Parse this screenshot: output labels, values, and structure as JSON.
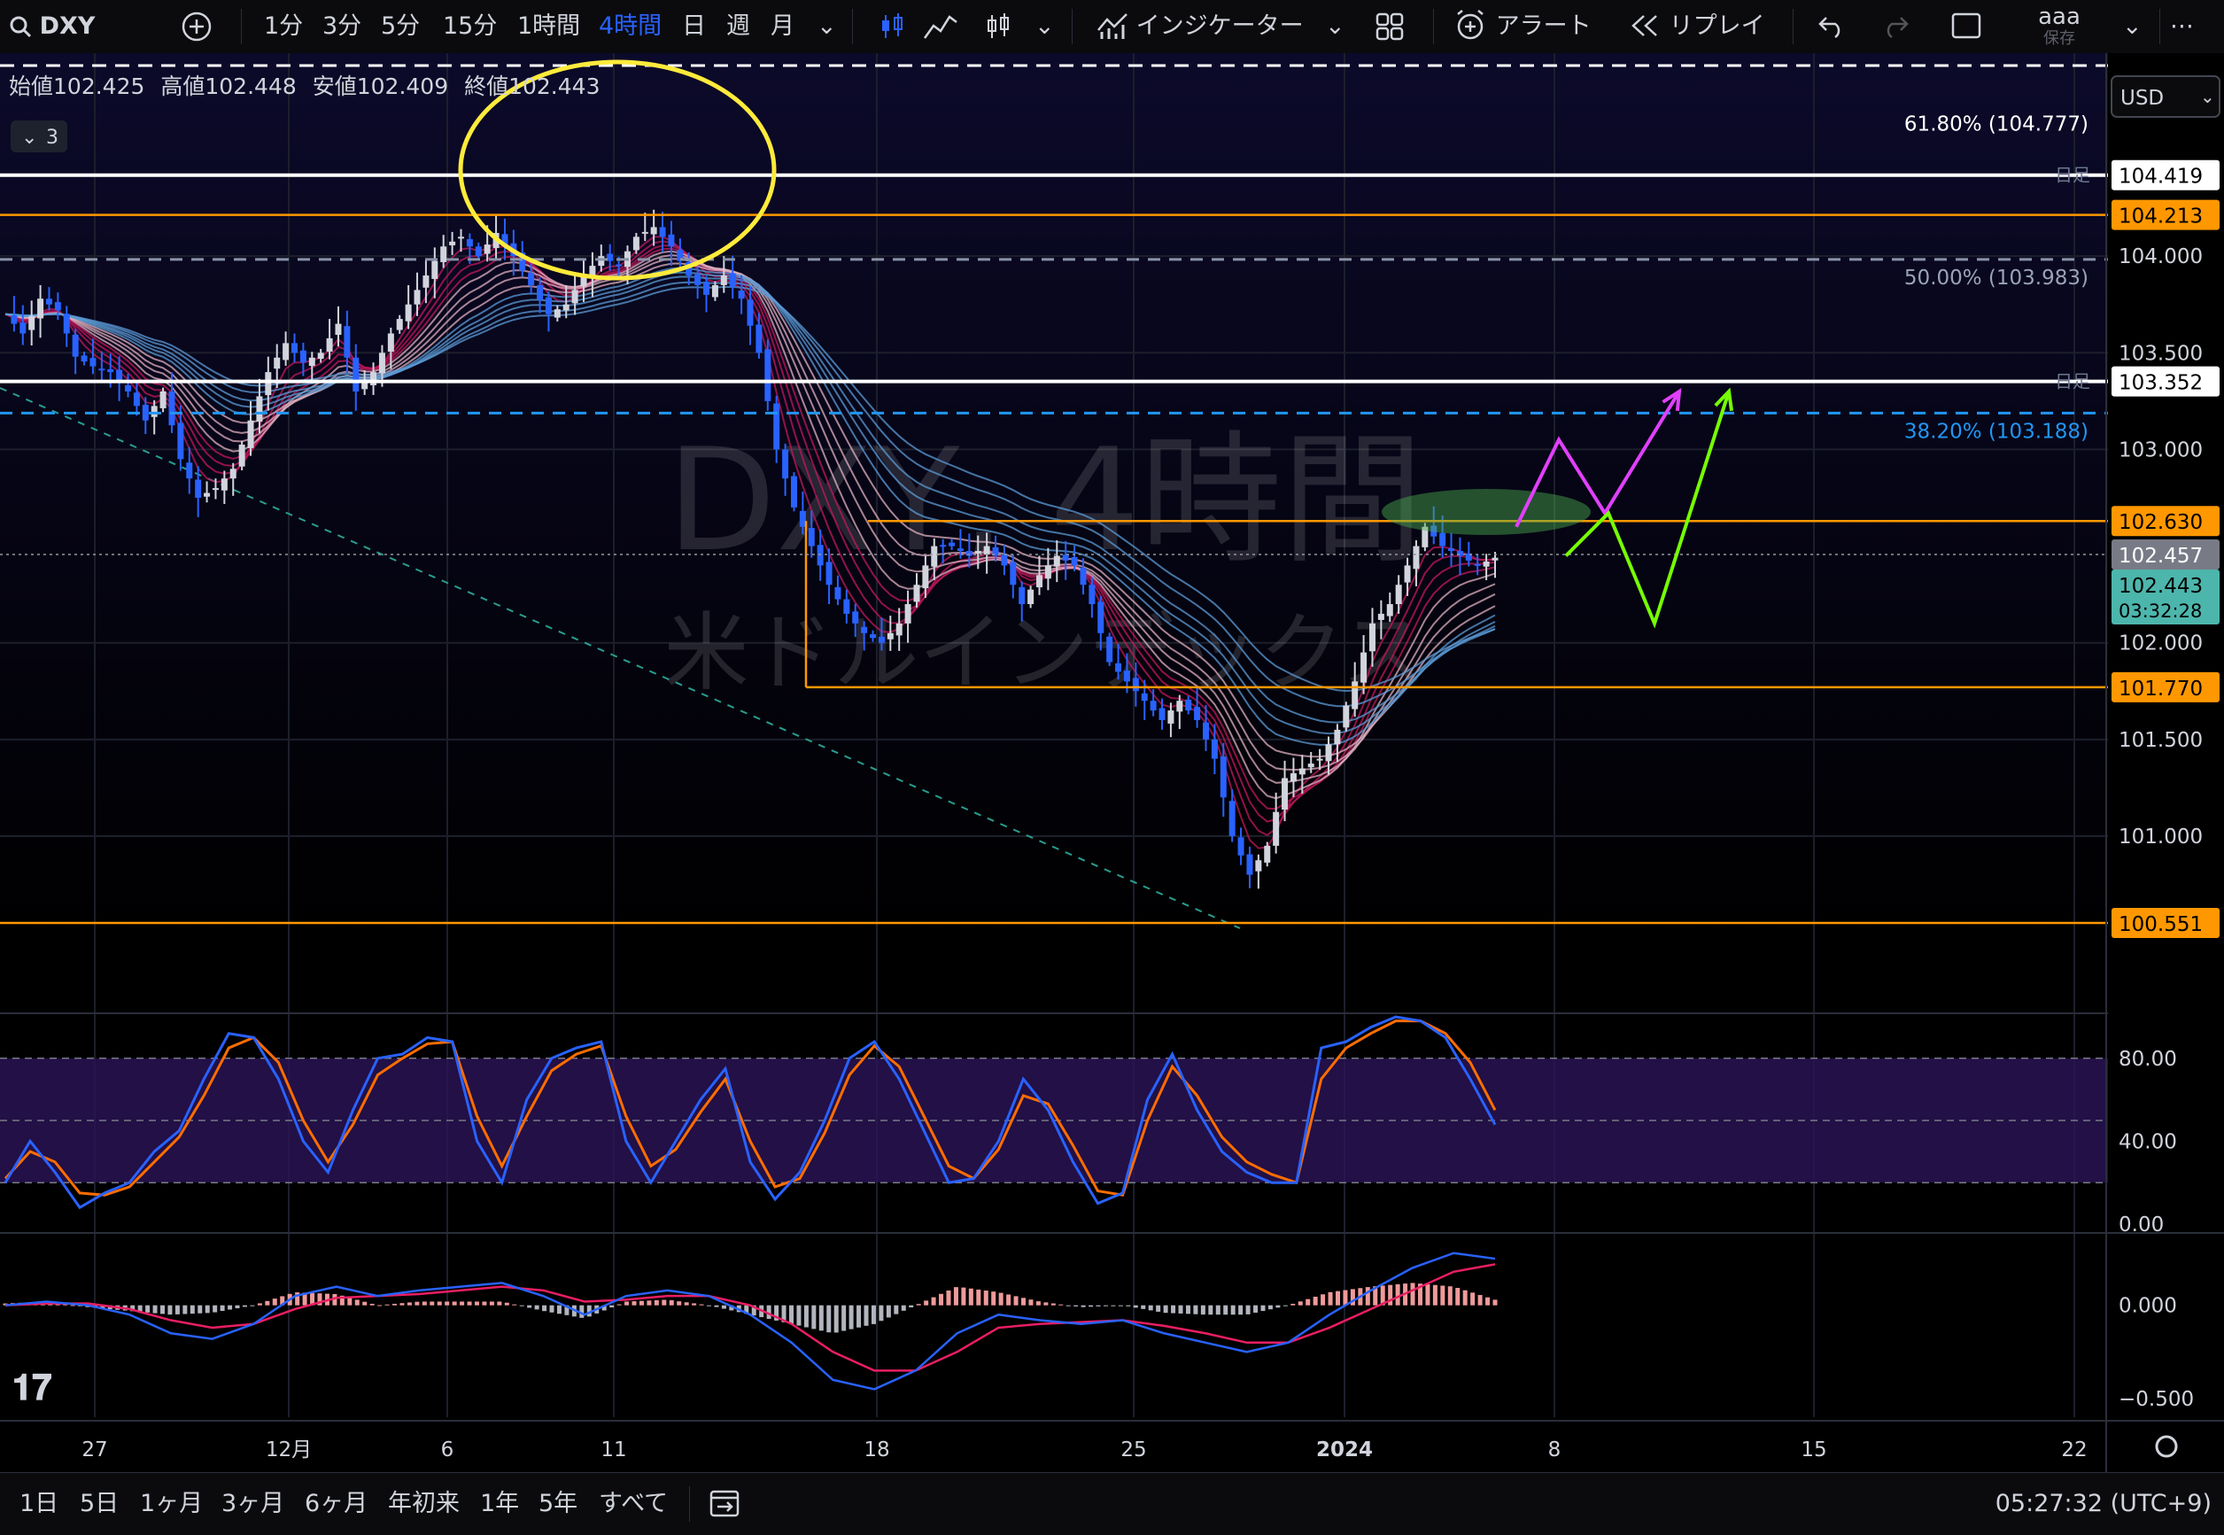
{
  "symbol": "DXY",
  "toolbar": {
    "intervals": [
      "1分",
      "3分",
      "5分",
      "15分",
      "1時間",
      "4時間",
      "日",
      "週",
      "月"
    ],
    "active_interval": "4時間",
    "indicators_label": "インジケーター",
    "alert_label": "アラート",
    "replay_label": "リプレイ",
    "user_name": "aaa",
    "save_label": "保存"
  },
  "legend": {
    "open_label": "始値",
    "open": "102.425",
    "high_label": "高値",
    "high": "102.448",
    "low_label": "安値",
    "low": "102.409",
    "close_label": "終値",
    "close": "102.443",
    "collapse_count": "3"
  },
  "currency": "USD",
  "watermark": {
    "title": "DXY, 4時間",
    "subtitle": "米ドルインデックス"
  },
  "bottom": {
    "ranges": [
      "1日",
      "5日",
      "1ヶ月",
      "3ヶ月",
      "6ヶ月",
      "年初来",
      "1年",
      "5年",
      "すべて"
    ],
    "clock": "05:27:32 (UTC+9)"
  },
  "colors": {
    "up": "#d1d4dc",
    "down": "#2962ff",
    "orange": "#ff9800",
    "fib_blue": "#2196f3",
    "ribbon_red": "#c2185b",
    "ribbon_blue": "#5b9bd5",
    "stoch_k": "#2962ff",
    "stoch_d": "#ff6d00",
    "macd_line": "#2962ff",
    "signal_line": "#e91e63",
    "hist_pos": "#ef9a9a",
    "hist_neg": "#b2b5be"
  },
  "chart_data": {
    "type": "candlestick",
    "price_axis": {
      "ticks": [
        "104.000",
        "103.500",
        "103.000",
        "102.000",
        "101.500",
        "101.000"
      ],
      "range": [
        100.45,
        105.05
      ]
    },
    "time_axis": {
      "ticks": [
        "27",
        "12月",
        "6",
        "11",
        "18",
        "25",
        "2024",
        "8",
        "15",
        "22"
      ]
    },
    "last_price": "102.443",
    "countdown": "03:32:28",
    "horizontal_levels": [
      {
        "price": 104.419,
        "label": "104.419",
        "style": "white",
        "tag": "日足"
      },
      {
        "price": 104.213,
        "label": "104.213",
        "style": "orange"
      },
      {
        "price": 103.352,
        "label": "103.352",
        "style": "white",
        "tag": "日足"
      },
      {
        "price": 102.63,
        "label": "102.630",
        "style": "orange"
      },
      {
        "price": 101.77,
        "label": "101.770",
        "style": "orange"
      },
      {
        "price": 100.551,
        "label": "100.551",
        "style": "orange"
      }
    ],
    "fib_levels": [
      {
        "label": "61.80% (104.777)",
        "price": 104.777
      },
      {
        "label": "50.00% (103.983)",
        "price": 103.983
      },
      {
        "label": "38.20% (103.188)",
        "price": 103.188
      }
    ],
    "crosshair_price": "102.457",
    "close_path": [
      [
        0,
        103.7
      ],
      [
        2,
        103.6
      ],
      [
        4,
        103.78
      ],
      [
        6,
        103.72
      ],
      [
        8,
        103.48
      ],
      [
        10,
        103.43
      ],
      [
        12,
        103.4
      ],
      [
        14,
        103.3
      ],
      [
        16,
        103.15
      ],
      [
        18,
        103.3
      ],
      [
        20,
        102.95
      ],
      [
        22,
        102.75
      ],
      [
        24,
        102.8
      ],
      [
        26,
        102.9
      ],
      [
        28,
        103.15
      ],
      [
        30,
        103.4
      ],
      [
        32,
        103.55
      ],
      [
        34,
        103.45
      ],
      [
        36,
        103.5
      ],
      [
        38,
        103.65
      ],
      [
        40,
        103.3
      ],
      [
        42,
        103.4
      ],
      [
        44,
        103.6
      ],
      [
        46,
        103.75
      ],
      [
        48,
        103.9
      ],
      [
        50,
        104.05
      ],
      [
        52,
        104.1
      ],
      [
        54,
        104.0
      ],
      [
        56,
        104.12
      ],
      [
        58,
        104.0
      ],
      [
        60,
        103.85
      ],
      [
        62,
        103.7
      ],
      [
        64,
        103.75
      ],
      [
        66,
        103.9
      ],
      [
        68,
        104.0
      ],
      [
        70,
        103.95
      ],
      [
        72,
        104.1
      ],
      [
        74,
        104.15
      ],
      [
        76,
        104.05
      ],
      [
        78,
        103.9
      ],
      [
        80,
        103.8
      ],
      [
        82,
        103.9
      ],
      [
        84,
        103.78
      ],
      [
        86,
        103.5
      ],
      [
        88,
        103.0
      ],
      [
        90,
        102.7
      ],
      [
        92,
        102.5
      ],
      [
        94,
        102.3
      ],
      [
        96,
        102.15
      ],
      [
        98,
        102.05
      ],
      [
        100,
        102.0
      ],
      [
        102,
        102.1
      ],
      [
        104,
        102.3
      ],
      [
        106,
        102.5
      ],
      [
        108,
        102.5
      ],
      [
        110,
        102.45
      ],
      [
        112,
        102.5
      ],
      [
        114,
        102.4
      ],
      [
        116,
        102.2
      ],
      [
        118,
        102.35
      ],
      [
        120,
        102.45
      ],
      [
        122,
        102.4
      ],
      [
        124,
        102.2
      ],
      [
        126,
        101.9
      ],
      [
        128,
        101.8
      ],
      [
        130,
        101.7
      ],
      [
        132,
        101.6
      ],
      [
        134,
        101.7
      ],
      [
        136,
        101.6
      ],
      [
        138,
        101.4
      ],
      [
        140,
        101.0
      ],
      [
        142,
        100.8
      ],
      [
        144,
        100.95
      ],
      [
        146,
        101.3
      ],
      [
        148,
        101.35
      ],
      [
        150,
        101.4
      ],
      [
        152,
        101.55
      ],
      [
        154,
        101.8
      ],
      [
        156,
        102.1
      ],
      [
        158,
        102.2
      ],
      [
        160,
        102.4
      ],
      [
        162,
        102.6
      ],
      [
        164,
        102.5
      ],
      [
        166,
        102.45
      ],
      [
        168,
        102.4
      ],
      [
        170,
        102.44
      ]
    ],
    "projections": [
      {
        "color": "#e040fb",
        "points": [
          [
            102.6
          ],
          [
            103.05
          ],
          [
            102.67
          ],
          [
            103.3
          ]
        ]
      },
      {
        "color": "#76ff03",
        "points": [
          [
            102.45
          ],
          [
            102.67
          ],
          [
            102.1
          ],
          [
            103.3
          ]
        ]
      }
    ],
    "stochastic": {
      "ticks": [
        "80.00",
        "40.00",
        "0.00"
      ],
      "band": [
        20,
        80
      ],
      "k": [
        20,
        40,
        25,
        8,
        15,
        20,
        35,
        45,
        70,
        92,
        90,
        70,
        40,
        25,
        55,
        80,
        82,
        90,
        88,
        40,
        20,
        60,
        80,
        85,
        88,
        40,
        20,
        40,
        60,
        75,
        30,
        12,
        25,
        50,
        80,
        88,
        70,
        45,
        20,
        22,
        40,
        70,
        55,
        30,
        10,
        15,
        60,
        82,
        55,
        35,
        25,
        20,
        20,
        85,
        88,
        95,
        100,
        98,
        90,
        70,
        48
      ],
      "d": [
        22,
        35,
        30,
        15,
        14,
        18,
        30,
        42,
        62,
        85,
        90,
        78,
        50,
        30,
        48,
        72,
        80,
        87,
        88,
        52,
        28,
        52,
        74,
        82,
        86,
        52,
        28,
        36,
        54,
        70,
        40,
        18,
        22,
        44,
        72,
        86,
        76,
        52,
        28,
        22,
        36,
        62,
        58,
        38,
        16,
        14,
        50,
        76,
        62,
        42,
        30,
        24,
        20,
        70,
        85,
        92,
        98,
        98,
        92,
        78,
        55
      ]
    },
    "macd": {
      "ticks": [
        "0.000",
        "−0.500"
      ],
      "range": [
        -0.6,
        0.35
      ],
      "macd": [
        0.0,
        0.02,
        0.0,
        -0.05,
        -0.15,
        -0.18,
        -0.1,
        0.05,
        0.1,
        0.05,
        0.08,
        0.1,
        0.12,
        0.05,
        -0.05,
        0.05,
        0.08,
        0.05,
        -0.05,
        -0.2,
        -0.4,
        -0.45,
        -0.35,
        -0.15,
        -0.05,
        -0.08,
        -0.1,
        -0.08,
        -0.15,
        -0.2,
        -0.25,
        -0.2,
        -0.05,
        0.08,
        0.2,
        0.28,
        0.25
      ],
      "signal": [
        0.0,
        0.01,
        0.01,
        -0.02,
        -0.08,
        -0.12,
        -0.1,
        -0.02,
        0.04,
        0.05,
        0.06,
        0.08,
        0.1,
        0.08,
        0.02,
        0.03,
        0.05,
        0.05,
        0.0,
        -0.1,
        -0.25,
        -0.35,
        -0.35,
        -0.25,
        -0.12,
        -0.1,
        -0.09,
        -0.08,
        -0.11,
        -0.15,
        -0.2,
        -0.2,
        -0.12,
        -0.02,
        0.08,
        0.18,
        0.22
      ],
      "hist": [
        0.01,
        0.02,
        -0.01,
        -0.03,
        -0.05,
        -0.04,
        0.0,
        0.07,
        0.06,
        0.0,
        0.02,
        0.02,
        0.02,
        -0.03,
        -0.07,
        0.02,
        0.03,
        0.0,
        -0.05,
        -0.1,
        -0.15,
        -0.1,
        0.0,
        0.1,
        0.07,
        0.02,
        -0.01,
        0.0,
        -0.04,
        -0.05,
        -0.05,
        0.0,
        0.07,
        0.1,
        0.12,
        0.1,
        0.03
      ]
    }
  }
}
